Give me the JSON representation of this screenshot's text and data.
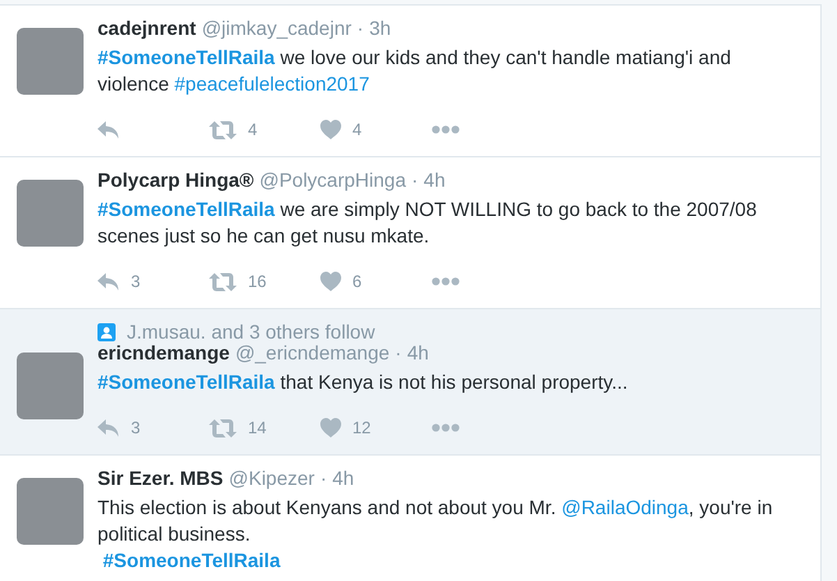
{
  "tweets": [
    {
      "name": "cadejnrent",
      "handle": "@jimkay_cadejnr",
      "separator": "·",
      "time": "3h",
      "shaded": false,
      "body": [
        {
          "kind": "hashtag",
          "text": "#SomeoneTellRaila"
        },
        {
          "kind": "text",
          "text": " we love our kids and they can't handle matiang'i and violence "
        },
        {
          "kind": "link",
          "text": "#peacefulelection2017"
        }
      ],
      "actions": {
        "retweets": "4",
        "likes": "4"
      }
    },
    {
      "name": "Polycarp Hinga®",
      "handle": "@PolycarpHinga",
      "separator": "·",
      "time": "4h",
      "shaded": false,
      "body": [
        {
          "kind": "hashtag",
          "text": "#SomeoneTellRaila"
        },
        {
          "kind": "text",
          "text": " we are simply NOT WILLING to go back to the 2007/08 scenes just so he can get nusu mkate."
        }
      ],
      "actions": {
        "replies": "3",
        "retweets": "16",
        "likes": "6"
      }
    },
    {
      "name": "ericndemange",
      "handle": "@_ericndemange",
      "separator": "·",
      "time": "4h",
      "shaded": true,
      "context": "J.musau. and 3 others follow",
      "body": [
        {
          "kind": "hashtag",
          "text": "#SomeoneTellRaila"
        },
        {
          "kind": "text",
          "text": " that Kenya is not his personal property..."
        }
      ],
      "actions": {
        "replies": "3",
        "retweets": "14",
        "likes": "12"
      }
    },
    {
      "name": "Sir Ezer. MBS",
      "handle": "@Kipezer",
      "separator": "·",
      "time": "4h",
      "shaded": false,
      "body": [
        {
          "kind": "text",
          "text": "This election is about Kenyans and not about you Mr. "
        },
        {
          "kind": "link",
          "text": "@RailaOdinga"
        },
        {
          "kind": "text",
          "text": ", you're in political business."
        },
        {
          "kind": "break"
        },
        {
          "kind": "hashtag",
          "text": " #SomeoneTellRaila"
        }
      ]
    }
  ]
}
